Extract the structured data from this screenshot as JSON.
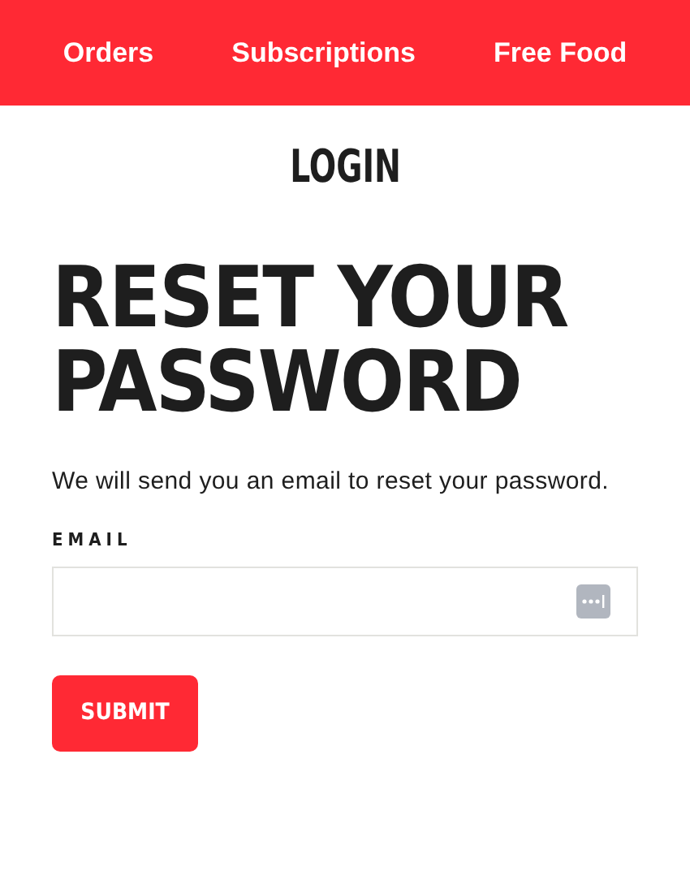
{
  "nav": {
    "items": [
      {
        "label": "Orders"
      },
      {
        "label": "Subscriptions"
      },
      {
        "label": "Free Food"
      }
    ]
  },
  "section_title": "LOGIN",
  "heading": "RESET YOUR PASSWORD",
  "description": "We will send you an email to reset your password.",
  "email_field": {
    "label": "EMAIL"
  },
  "submit_button": "SUBMIT"
}
